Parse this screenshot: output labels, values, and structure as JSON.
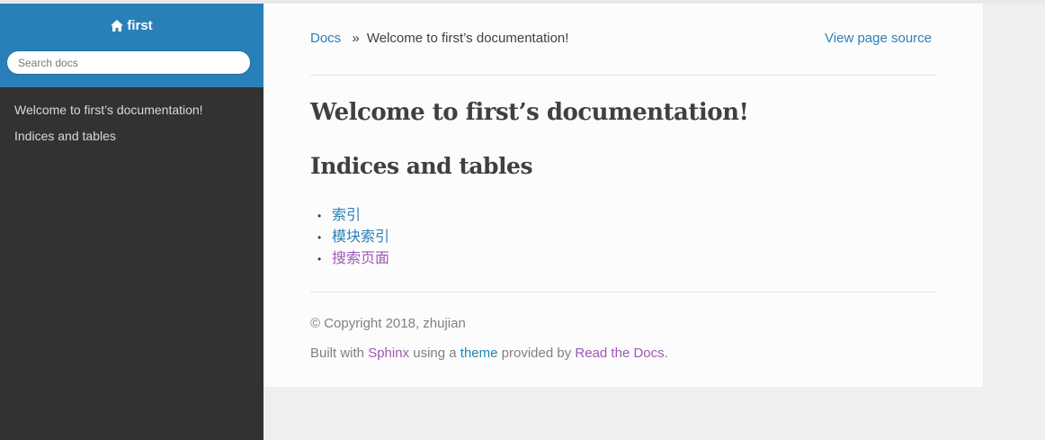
{
  "colors": {
    "sidebar_bg": "#343131",
    "brand_bg": "#2980b9",
    "link": "#2980b9",
    "visited_link": "#9b59b6",
    "text": "#404040"
  },
  "sidebar": {
    "project_title": "first",
    "home_icon": "home-icon",
    "search_placeholder": "Search docs",
    "menu_items": [
      {
        "label": "Welcome to first’s documentation!"
      },
      {
        "label": "Indices and tables"
      }
    ]
  },
  "breadcrumb": {
    "root": "Docs",
    "separator": "»",
    "current": "Welcome to first’s documentation!",
    "view_source": "View page source"
  },
  "main": {
    "title": "Welcome to first’s documentation!",
    "section_title": "Indices and tables",
    "links": [
      {
        "label": "索引",
        "color": "#2980b9"
      },
      {
        "label": "模块索引",
        "color": "#2980b9"
      },
      {
        "label": "搜索页面",
        "color": "#9b59b6"
      }
    ]
  },
  "footer": {
    "copyright": "© Copyright 2018, zhujian",
    "built_with": "Built with",
    "sphinx": "Sphinx",
    "using_a": "using a",
    "theme": "theme",
    "provided_by": "provided by",
    "rtd": "Read the Docs",
    "period": "."
  }
}
